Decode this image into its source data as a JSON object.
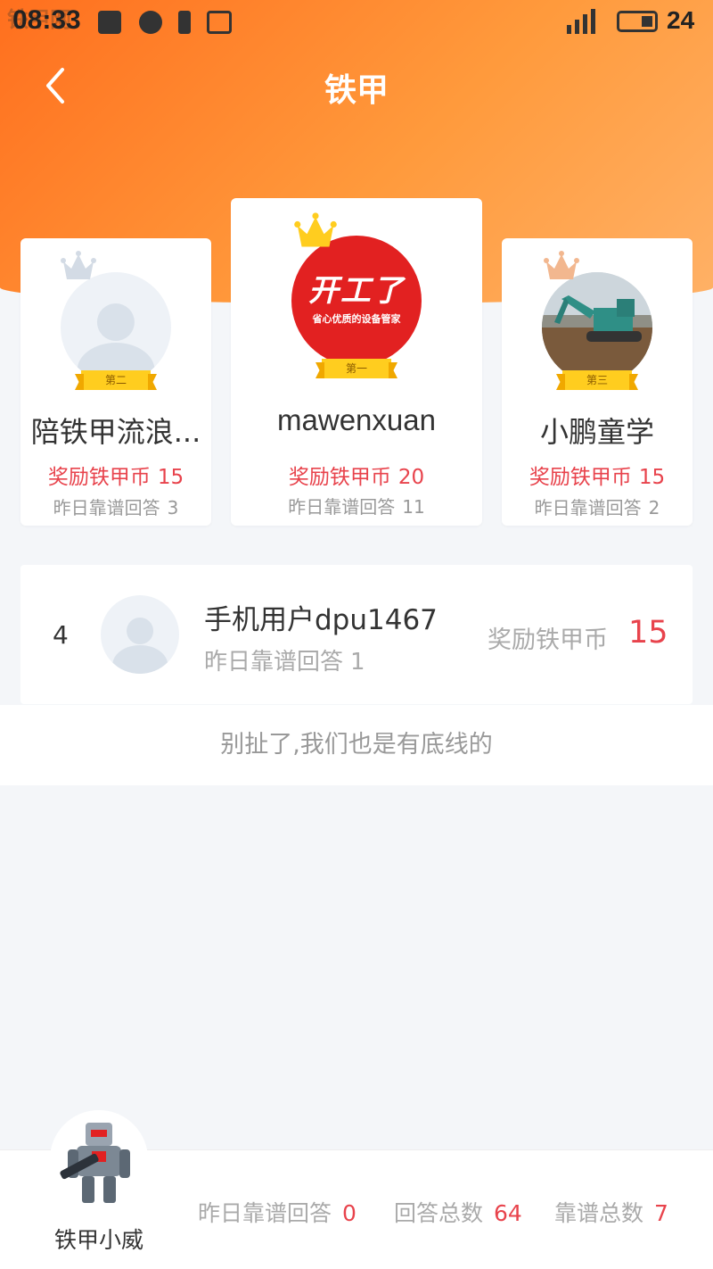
{
  "status_bar": {
    "time": "08:33",
    "battery": "24",
    "watermark": "铁甲网"
  },
  "nav": {
    "title": "铁甲"
  },
  "podium": [
    {
      "rank_label": "第二",
      "name": "陪铁甲流浪...",
      "reward_label": "奖励铁甲币",
      "reward_value": "15",
      "sub_label": "昨日靠谱回答",
      "sub_value": "3",
      "crown_color": "#c9d2de"
    },
    {
      "rank_label": "第一",
      "name": "mawenxuan",
      "reward_label": "奖励铁甲币",
      "reward_value": "20",
      "sub_label": "昨日靠谱回答",
      "sub_value": "11",
      "crown_color": "#ffcd1f",
      "logo_main": "开工了",
      "logo_sub": "省心优质的设备管家"
    },
    {
      "rank_label": "第三",
      "name": "小鹏童学",
      "reward_label": "奖励铁甲币",
      "reward_value": "15",
      "sub_label": "昨日靠谱回答",
      "sub_value": "2",
      "crown_color": "#f2b78f"
    }
  ],
  "list": [
    {
      "rank": "4",
      "name": "手机用户dpu1467",
      "sub_label": "昨日靠谱回答",
      "sub_value": "1",
      "reward_label": "奖励铁甲币",
      "reward_value": "15"
    }
  ],
  "footer_note": "别扯了,我们也是有底线的",
  "me": {
    "name": "铁甲小威",
    "stats": [
      {
        "label": "昨日靠谱回答",
        "value": "0"
      },
      {
        "label": "回答总数",
        "value": "64"
      },
      {
        "label": "靠谱总数",
        "value": "7"
      }
    ]
  },
  "colors": {
    "accent": "#ff7a22",
    "reward": "#e8434c"
  }
}
